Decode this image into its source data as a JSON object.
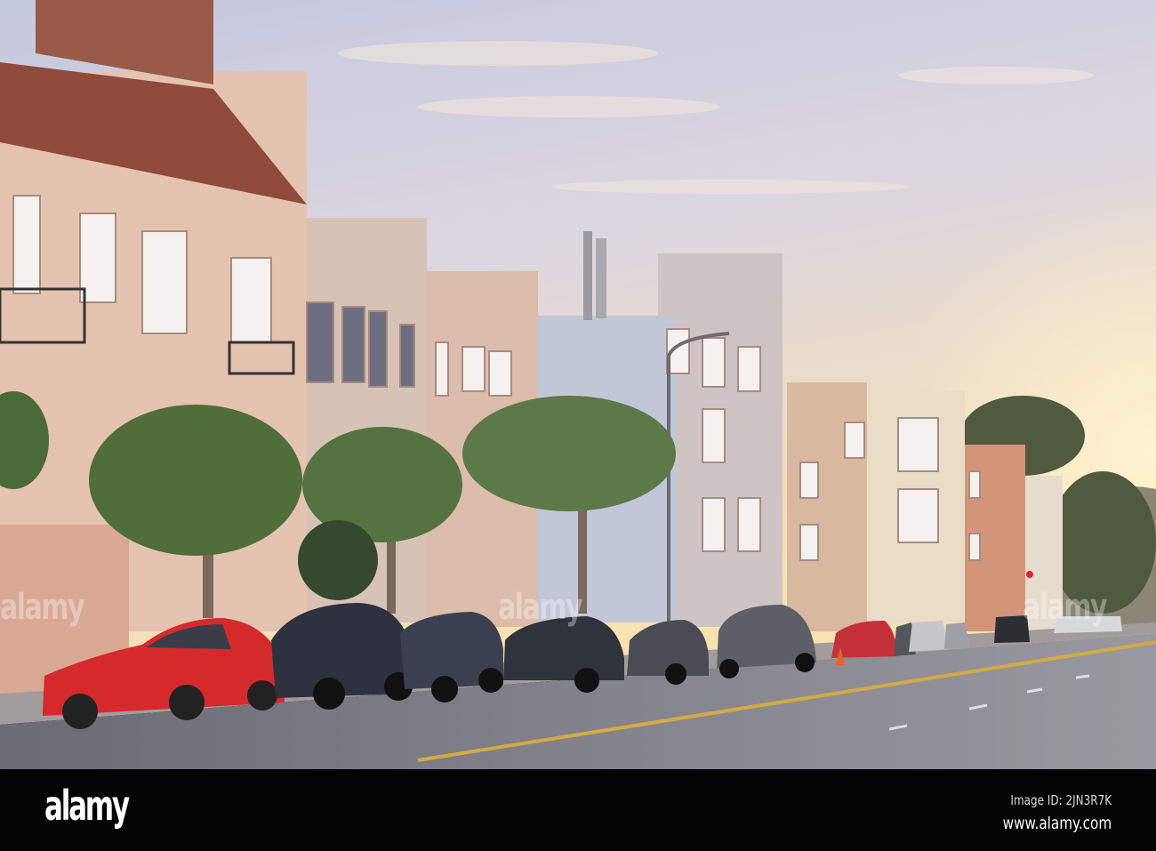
{
  "photo": {
    "subject": "street-scene",
    "colors": {
      "sky_top": "#c9cde0",
      "sky_bottom": "#f7e3b8",
      "road": "#6e7079",
      "building_pink": "#e4c3b0"
    }
  },
  "watermark": {
    "overlay_text": "alamy"
  },
  "footer": {
    "logo": "alamy",
    "image_id": "Image ID: 2JN3R7K",
    "website": "www.alamy.com"
  }
}
